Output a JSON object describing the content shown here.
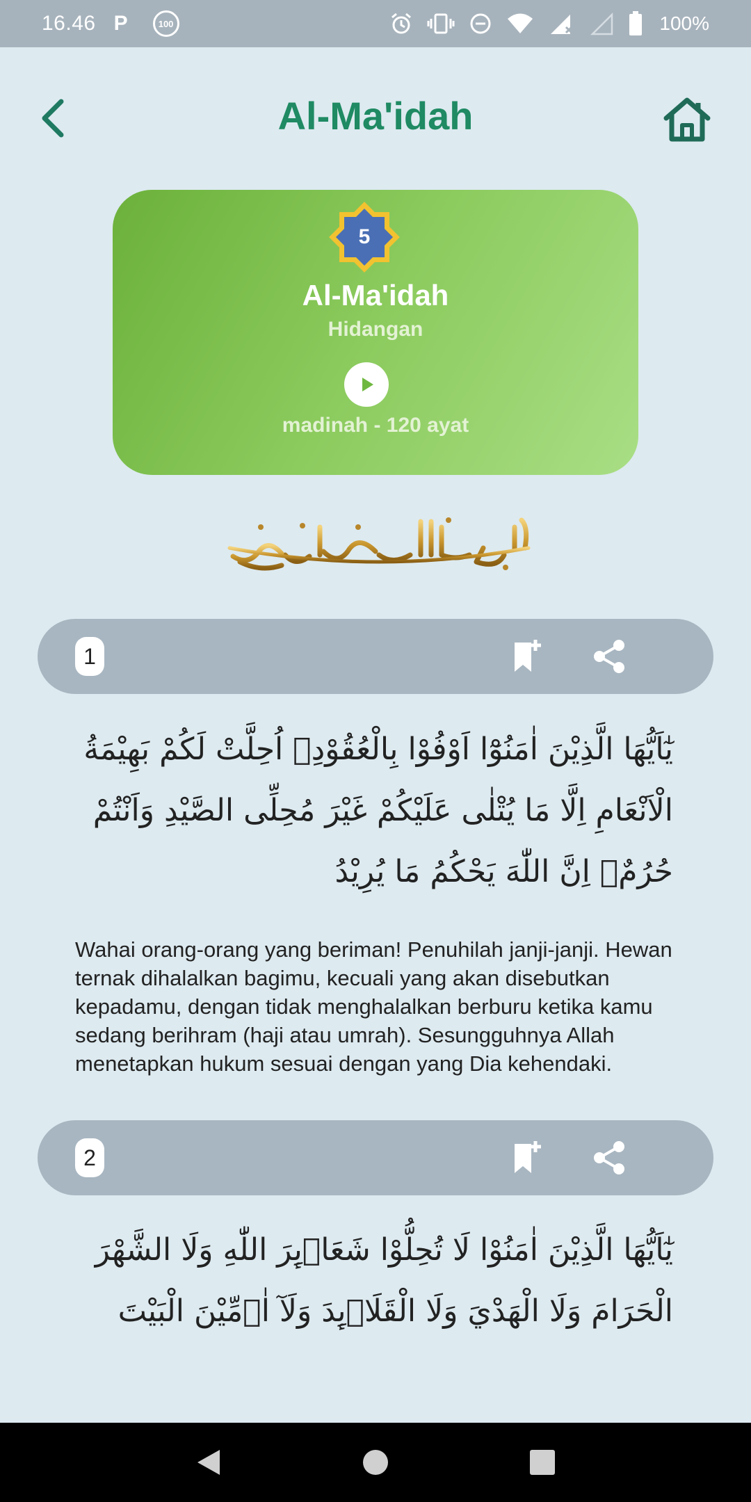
{
  "status_bar": {
    "time": "16.46",
    "p_icon": "P",
    "notification_badge": "100",
    "battery": "100%",
    "icons": [
      "alarm-icon",
      "vibrate-icon",
      "dnd-icon",
      "wifi-icon",
      "signal-icon",
      "signal-empty-icon",
      "battery-icon"
    ]
  },
  "header": {
    "title": "Al-Ma'idah",
    "back_icon": "chevron-left-icon",
    "home_icon": "home-icon"
  },
  "surah_card": {
    "number": "5",
    "name": "Al-Ma'idah",
    "meaning": "Hidangan",
    "info": "madinah - 120 ayat",
    "play_icon": "play-icon"
  },
  "basmalah_icon": "basmalah-calligraphy",
  "ayahs": [
    {
      "number": "1",
      "arabic": "يٰٓاَيُّهَا الَّذِيْنَ اٰمَنُوْٓا اَوْفُوْا بِالْعُقُوْدِۗ اُحِلَّتْ لَكُمْ بَهِيْمَةُ الْاَنْعَامِ اِلَّا مَا يُتْلٰى عَلَيْكُمْ غَيْرَ مُحِلِّى الصَّيْدِ وَاَنْتُمْ حُرُمٌۗ اِنَّ اللّٰهَ يَحْكُمُ مَا يُرِيْدُ",
      "translation": "Wahai orang-orang yang beriman! Penuhilah janji-janji. Hewan ternak dihalalkan bagimu, kecuali yang akan disebutkan kepadamu, dengan tidak menghalalkan berburu ketika kamu sedang berihram (haji atau umrah). Sesungguhnya Allah menetapkan hukum sesuai dengan yang Dia kehendaki."
    },
    {
      "number": "2",
      "arabic": "يٰٓاَيُّهَا الَّذِيْنَ اٰمَنُوْا لَا تُحِلُّوْا شَعَاۤىِٕرَ اللّٰهِ وَلَا الشَّهْرَ الْحَرَامَ وَلَا الْهَدْيَ وَلَا الْقَلَاۤىِٕدَ وَلَآ اٰۤمِّيْنَ الْبَيْتَ"
    }
  ],
  "actions": {
    "bookmark_icon": "bookmark-add-icon",
    "share_icon": "share-icon"
  },
  "nav_bar": {
    "icons": [
      "nav-back-icon",
      "nav-home-icon",
      "nav-recents-icon"
    ]
  },
  "colors": {
    "background": "#ddeaf0",
    "title": "#1f8a63",
    "card_start": "#6cb13b",
    "card_end": "#a9de85",
    "ayah_bar": "#a8b6c1",
    "badge_gold": "#f2c230",
    "badge_blue": "#4a6fb5"
  }
}
